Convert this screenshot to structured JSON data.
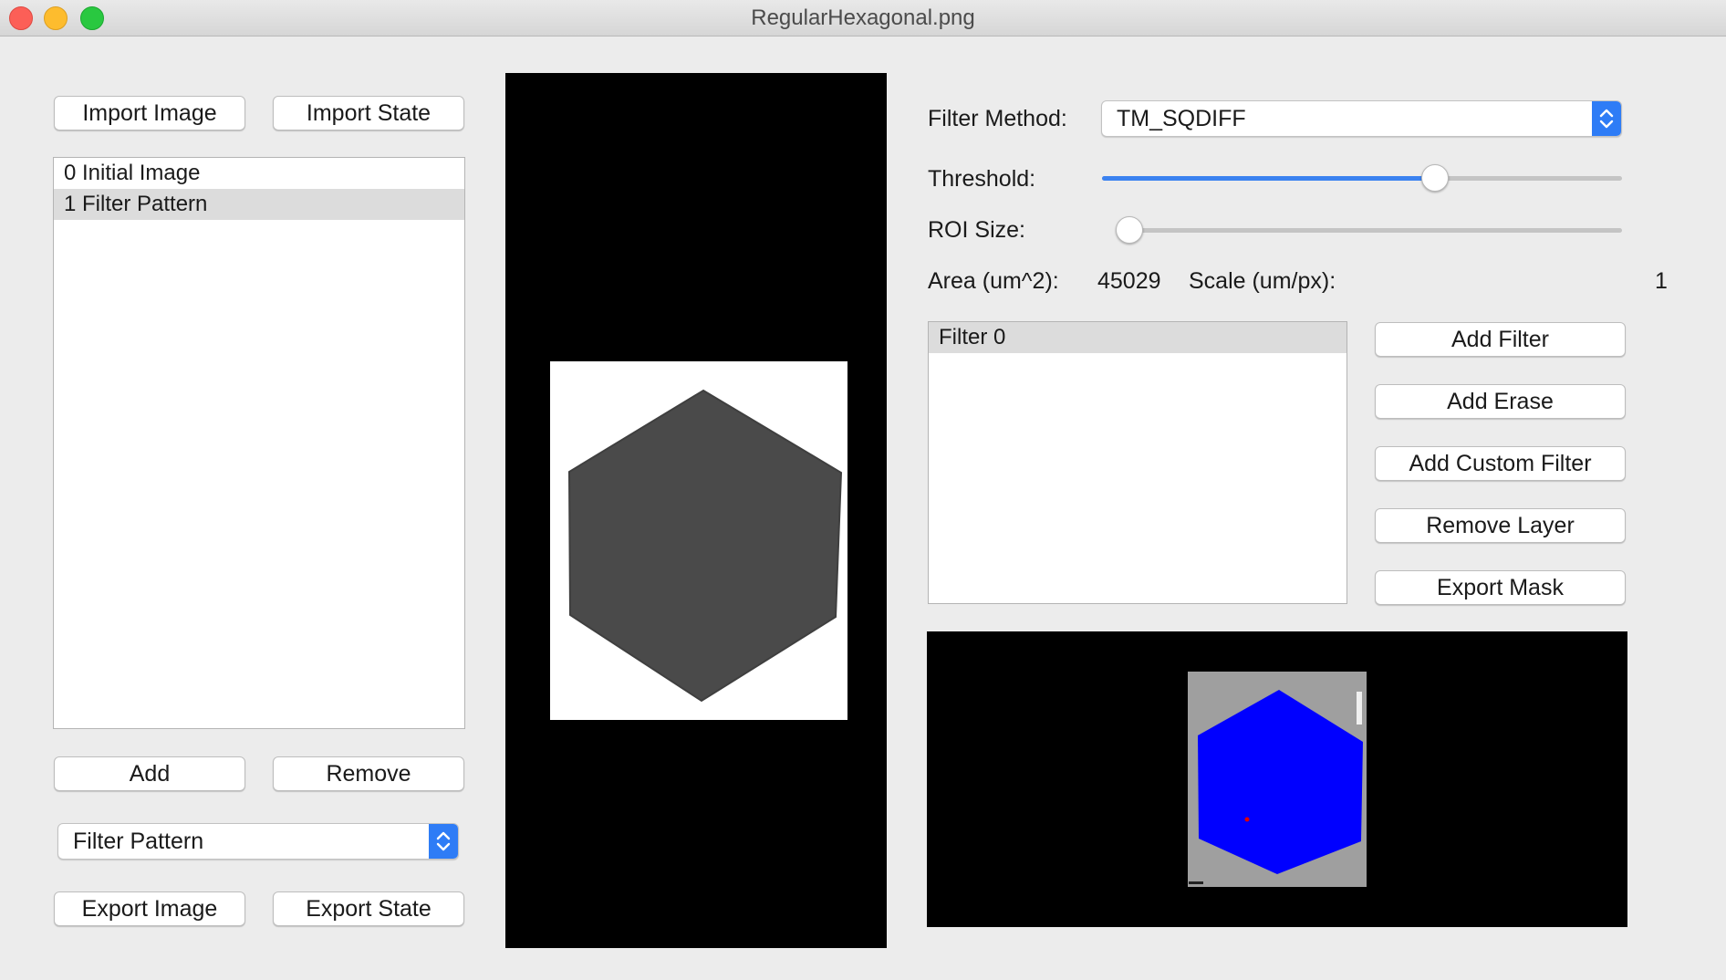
{
  "window": {
    "title": "RegularHexagonal.png"
  },
  "left_panel": {
    "import_image_label": "Import Image",
    "import_state_label": "Import State",
    "layers": [
      {
        "label": "0 Initial Image",
        "selected": false
      },
      {
        "label": "1 Filter Pattern",
        "selected": true
      }
    ],
    "add_label": "Add",
    "remove_label": "Remove",
    "layer_type_selected": "Filter Pattern",
    "export_image_label": "Export Image",
    "export_state_label": "Export State"
  },
  "controls": {
    "filter_method_label": "Filter Method:",
    "filter_method_value": "TM_SQDIFF",
    "threshold_label": "Threshold:",
    "threshold_level": 0.64,
    "roi_size_label": "ROI Size:",
    "roi_size_level": 0.0,
    "area_label": "Area (um^2):",
    "area_value": "45029",
    "scale_label": "Scale (um/px):",
    "scale_value": "1"
  },
  "filters": {
    "items": [
      {
        "label": "Filter 0",
        "selected": true
      }
    ],
    "add_filter_label": "Add Filter",
    "add_erase_label": "Add Erase",
    "add_custom_filter_label": "Add Custom Filter",
    "remove_layer_label": "Remove Layer",
    "export_mask_label": "Export Mask"
  },
  "colors": {
    "accent": "#2e7cf6",
    "slider_fill": "#3b82f0",
    "hexagon_gray": "#4a4a4a",
    "mask_blue": "#0000ff"
  },
  "icons": {
    "stepper": "up-down-chevron-icon"
  }
}
